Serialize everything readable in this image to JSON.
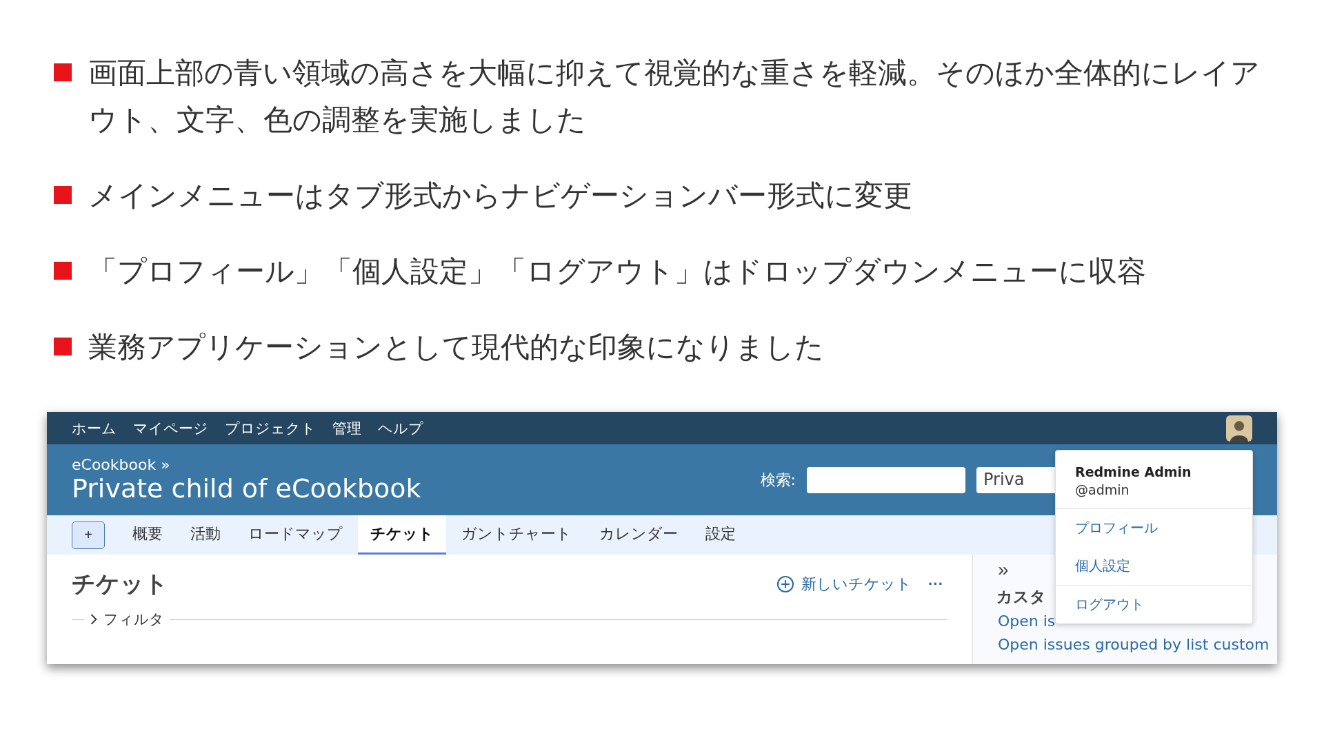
{
  "bullets": [
    "画面上部の青い領域の高さを大幅に抑えて視覚的な重さを軽減。そのほか全体的にレイアウト、文字、色の調整を実施しました",
    "メインメニューはタブ形式からナビゲーションバー形式に変更",
    "「プロフィール」「個人設定」「ログアウト」はドロップダウンメニューに収容",
    "業務アプリケーションとして現代的な印象になりました"
  ],
  "app": {
    "top_menu": [
      "ホーム",
      "マイページ",
      "プロジェクト",
      "管理",
      "ヘルプ"
    ],
    "breadcrumb": "eCookbook »",
    "project_title": "Private child of eCookbook",
    "search_label": "検索:",
    "project_select": "Priva",
    "add_button": "+",
    "tabs": [
      {
        "label": "概要",
        "selected": false
      },
      {
        "label": "活動",
        "selected": false
      },
      {
        "label": "ロードマップ",
        "selected": false
      },
      {
        "label": "チケット",
        "selected": true
      },
      {
        "label": "ガントチャート",
        "selected": false
      },
      {
        "label": "カレンダー",
        "selected": false
      },
      {
        "label": "設定",
        "selected": false
      }
    ],
    "heading": "チケット",
    "new_issue": "新しいチケット",
    "more": "···",
    "filter": "フィルタ",
    "sidebar": {
      "toggle": "»",
      "title": "カスタ",
      "links": [
        "Open is",
        "Open issues grouped by list custom"
      ]
    },
    "user_menu": {
      "name": "Redmine Admin",
      "login": "@admin",
      "items": [
        "プロフィール",
        "個人設定",
        "ログアウト"
      ]
    }
  }
}
